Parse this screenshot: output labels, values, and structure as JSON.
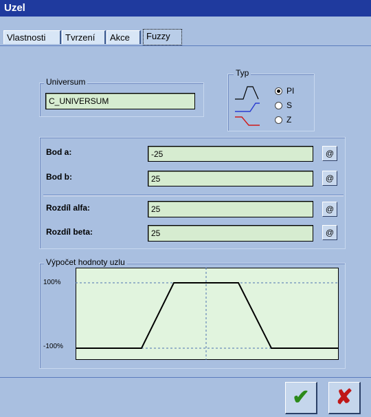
{
  "window": {
    "title": "Uzel"
  },
  "tabs": [
    {
      "label": "Vlastnosti"
    },
    {
      "label": "Tvrzení"
    },
    {
      "label": "Akce"
    },
    {
      "label": "Fuzzy"
    }
  ],
  "universum": {
    "legend": "Universum",
    "value": "C_UNIVERSUM"
  },
  "typ": {
    "legend": "Typ",
    "options": [
      {
        "label": "PI",
        "selected": true
      },
      {
        "label": "S",
        "selected": false
      },
      {
        "label": "Z",
        "selected": false
      }
    ]
  },
  "points": {
    "bod_a": {
      "label": "Bod a:",
      "value": "-25",
      "button": "@"
    },
    "bod_b": {
      "label": "Bod b:",
      "value": "25",
      "button": "@"
    },
    "alfa": {
      "label": "Rozdíl alfa:",
      "value": "25",
      "button": "@"
    },
    "beta": {
      "label": "Rozdíl beta:",
      "value": "25",
      "button": "@"
    }
  },
  "graph": {
    "legend": "Výpočet hodnoty uzlu",
    "top_label": "100%",
    "bottom_label": "-100%",
    "fill": "#e1f4de",
    "line_color": "#000000",
    "dash_color": "#4a6fb0"
  },
  "buttons": {
    "ok": "✔",
    "cancel": "✘",
    "ok_color": "#2c8a1a",
    "cancel_color": "#c01818"
  }
}
